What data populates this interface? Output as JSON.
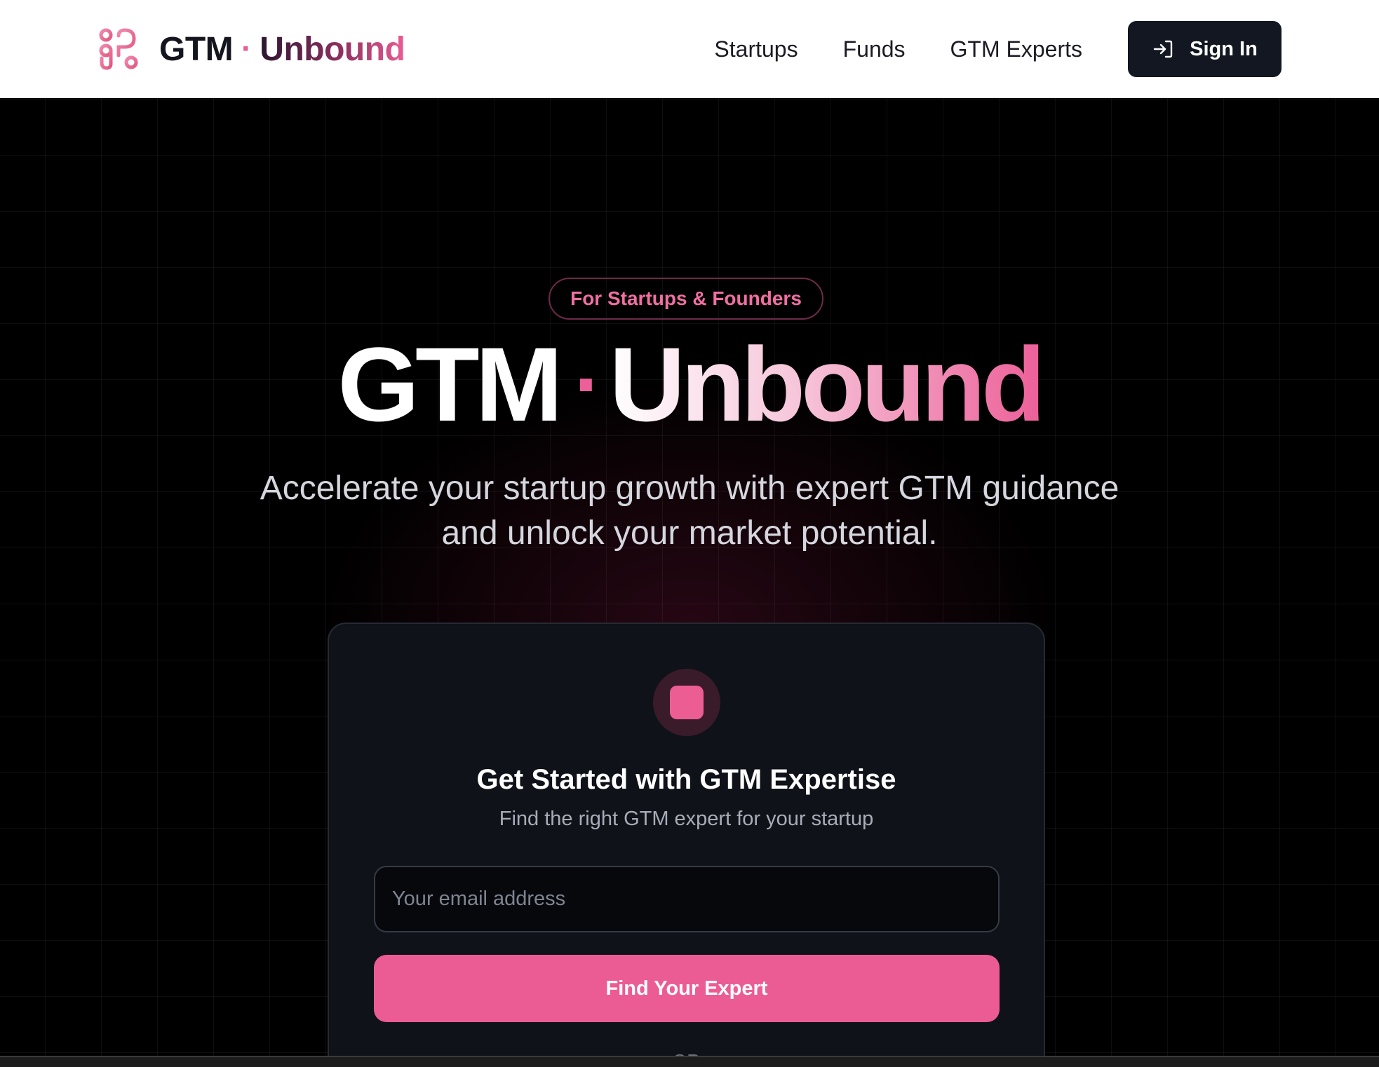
{
  "header": {
    "brand": {
      "gtm": "GTM",
      "dot": "·",
      "unbound": "Unbound",
      "logo_icon": "pretzel-logo-icon"
    },
    "nav": [
      "Startups",
      "Funds",
      "GTM Experts"
    ],
    "signin": {
      "label": "Sign In",
      "icon": "sign-in-icon"
    }
  },
  "hero": {
    "pill": "For Startups & Founders",
    "title": {
      "gtm": "GTM",
      "dot": "·",
      "unbound": "Unbound"
    },
    "tagline_line1": "Accelerate your startup growth with expert GTM guidance",
    "tagline_line2": "and unlock your market potential."
  },
  "card": {
    "title": "Get Started with GTM Expertise",
    "subtitle": "Find the right GTM expert for your startup",
    "email_placeholder": "Your email address",
    "email_value": "",
    "cta": "Find Your Expert",
    "divider": "OR"
  },
  "colors": {
    "accent": "#ec5c94",
    "background": "#000000",
    "card": "#0f1219",
    "header": "#ffffff",
    "signin_bg": "#121722"
  }
}
